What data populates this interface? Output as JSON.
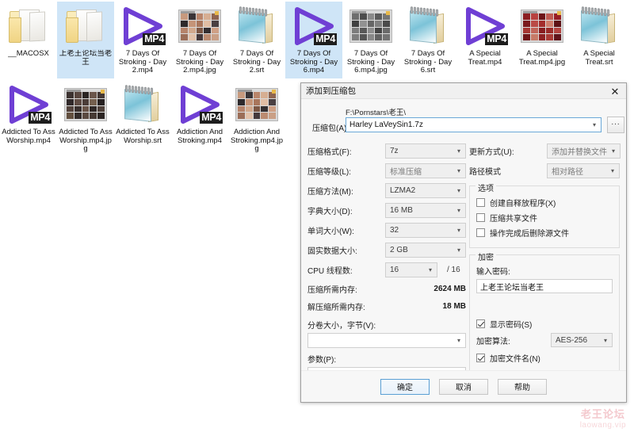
{
  "desktop": {
    "files": [
      {
        "name": "__MACOSX",
        "icon": "folder-icon",
        "selected": false,
        "kind": "folder"
      },
      {
        "name": "上老王论坛当老王",
        "icon": "folder-icon",
        "selected": true,
        "kind": "folder"
      },
      {
        "name": "7 Days Of Stroking - Day 2.mp4",
        "icon": "mp4-video-icon",
        "badge": "MP4",
        "selected": false,
        "kind": "mp4"
      },
      {
        "name": "7 Days Of Stroking - Day 2.mp4.jpg",
        "icon": "image-thumbnail-icon",
        "selected": false,
        "kind": "jpg",
        "palette": "skin"
      },
      {
        "name": "7 Days Of Stroking - Day 2.srt",
        "icon": "subtitle-notepad-icon",
        "selected": false,
        "kind": "srt"
      },
      {
        "name": "7 Days Of Stroking - Day 6.mp4",
        "icon": "mp4-video-icon",
        "badge": "MP4",
        "selected": true,
        "kind": "mp4"
      },
      {
        "name": "7 Days Of Stroking - Day 6.mp4.jpg",
        "icon": "image-thumbnail-icon",
        "selected": false,
        "kind": "jpg",
        "palette": "gray"
      },
      {
        "name": "7 Days Of Stroking - Day 6.srt",
        "icon": "subtitle-notepad-icon",
        "selected": false,
        "kind": "srt"
      },
      {
        "name": "A Special Treat.mp4",
        "icon": "mp4-video-icon",
        "badge": "MP4",
        "selected": false,
        "kind": "mp4"
      },
      {
        "name": "A Special Treat.mp4.jpg",
        "icon": "image-thumbnail-icon",
        "selected": false,
        "kind": "jpg",
        "palette": "red"
      },
      {
        "name": "A Special Treat.srt",
        "icon": "subtitle-notepad-icon",
        "selected": false,
        "kind": "srt"
      },
      {
        "name": "Addicted To Ass Worship.mp4",
        "icon": "mp4-video-icon",
        "badge": "MP4",
        "selected": false,
        "kind": "mp4"
      },
      {
        "name": "Addicted To Ass Worship.mp4.jpg",
        "icon": "image-thumbnail-icon",
        "selected": false,
        "kind": "jpg",
        "palette": "dark"
      },
      {
        "name": "Addicted To Ass Worship.srt",
        "icon": "subtitle-notepad-icon",
        "selected": false,
        "kind": "srt"
      },
      {
        "name": "Addiction And Stroking.mp4",
        "icon": "mp4-video-icon",
        "badge": "MP4",
        "selected": false,
        "kind": "mp4"
      },
      {
        "name": "Addiction And Stroking.mp4.jpg",
        "icon": "image-thumbnail-icon",
        "selected": false,
        "kind": "jpg",
        "palette": "skin"
      }
    ]
  },
  "watermark": {
    "cn": "老王论坛",
    "en": "laowang.vip"
  },
  "dialog": {
    "title": "添加到压缩包",
    "close_icon": "✕",
    "archive": {
      "label": "压缩包(A):",
      "path": "F:\\Pornstars\\老王\\",
      "value": "Harley LaVeySin1.7z",
      "browse_label": "...",
      "placeholder": ""
    },
    "left_fields": [
      {
        "label": "压缩格式(F):",
        "value": "7z",
        "dim": false
      },
      {
        "label": "压缩等级(L):",
        "value": "标准压缩",
        "dim": true
      },
      {
        "label": "压缩方法(M):",
        "value": "LZMA2",
        "dim": false
      },
      {
        "label": "字典大小(D):",
        "value": "16 MB",
        "dim": false
      },
      {
        "label": "单词大小(W):",
        "value": "32",
        "dim": false
      },
      {
        "label": "固实数据大小:",
        "value": "2 GB",
        "dim": false
      }
    ],
    "cpu": {
      "label": "CPU 线程数:",
      "value": "16",
      "suffix": "/ 16"
    },
    "memory": [
      {
        "label": "压缩所需内存:",
        "value": "2624 MB"
      },
      {
        "label": "解压缩所需内存:",
        "value": "18 MB"
      }
    ],
    "split": {
      "label": "分卷大小，字节(V):",
      "value": ""
    },
    "params": {
      "label": "参数(P):",
      "value": ""
    },
    "right_fields": [
      {
        "label": "更新方式(U):",
        "value": "添加并替换文件"
      },
      {
        "label": "路径模式",
        "value": "相对路径"
      }
    ],
    "options": {
      "title": "选项",
      "items": [
        {
          "label": "创建自释放程序(X)",
          "checked": false
        },
        {
          "label": "压缩共享文件",
          "checked": false
        },
        {
          "label": "操作完成后删除源文件",
          "checked": false
        }
      ]
    },
    "encryption": {
      "title": "加密",
      "password_label": "输入密码:",
      "password_value": "上老王论坛当老王",
      "show_password": {
        "label": "显示密码(S)",
        "checked": true
      },
      "algorithm_label": "加密算法:",
      "algorithm_value": "AES-256",
      "encrypt_names": {
        "label": "加密文件名(N)",
        "checked": true
      }
    },
    "buttons": {
      "ok": "确定",
      "cancel": "取消",
      "help": "帮助"
    }
  }
}
